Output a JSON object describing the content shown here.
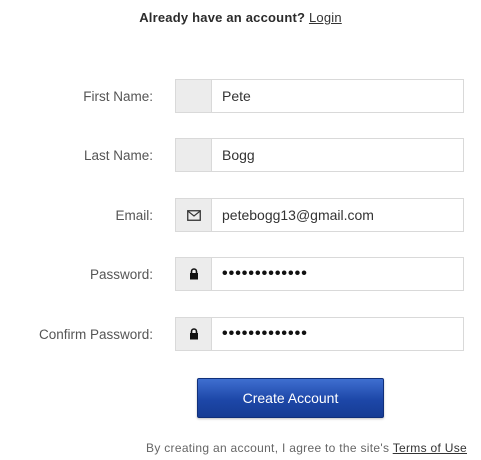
{
  "header": {
    "prompt": "Already have an account?",
    "login_link": "Login"
  },
  "form": {
    "first_name": {
      "label": "First Name:",
      "value": "Pete",
      "icon": "none"
    },
    "last_name": {
      "label": "Last Name:",
      "value": "Bogg",
      "icon": "none"
    },
    "email": {
      "label": "Email:",
      "value": "petebogg13@gmail.com",
      "icon": "envelope-icon"
    },
    "password": {
      "label": "Password:",
      "value": "•••••••••••••",
      "icon": "lock-icon"
    },
    "confirm_password": {
      "label": "Confirm Password:",
      "value": "•••••••••••••",
      "icon": "lock-icon"
    }
  },
  "create_button": {
    "label": "Create Account"
  },
  "footer": {
    "text": "By creating an account, I agree to the site's ",
    "terms_link": "Terms of Use"
  },
  "colors": {
    "button_top": "#3f6fd0",
    "button_bottom": "#163c94",
    "addon_bg": "#ececec",
    "border": "#d9d9d9"
  }
}
